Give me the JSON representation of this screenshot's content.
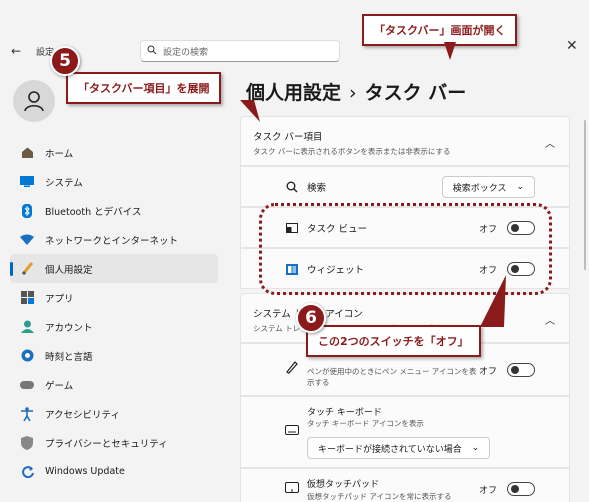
{
  "header": {
    "back_icon": "back-arrow-icon",
    "settings_label": "設定",
    "search_placeholder": "設定の検索"
  },
  "page_title": {
    "parent": "個人用設定",
    "separator": "›",
    "current": "タスク バー"
  },
  "sidebar": {
    "items": [
      {
        "label": "ホーム",
        "icon": "home-icon"
      },
      {
        "label": "システム",
        "icon": "system-icon"
      },
      {
        "label": "Bluetooth とデバイス",
        "icon": "bluetooth-icon"
      },
      {
        "label": "ネットワークとインターネット",
        "icon": "wifi-icon"
      },
      {
        "label": "個人用設定",
        "icon": "brush-icon",
        "active": true
      },
      {
        "label": "アプリ",
        "icon": "apps-icon"
      },
      {
        "label": "アカウント",
        "icon": "account-icon"
      },
      {
        "label": "時刻と言語",
        "icon": "globe-icon"
      },
      {
        "label": "ゲーム",
        "icon": "gamepad-icon"
      },
      {
        "label": "アクセシビリティ",
        "icon": "accessibility-icon"
      },
      {
        "label": "プライバシーとセキュリティ",
        "icon": "shield-icon"
      },
      {
        "label": "Windows Update",
        "icon": "update-icon"
      }
    ]
  },
  "taskbar_items": {
    "title": "タスク バー項目",
    "subtitle": "タスク バーに表示されるボタンを表示または非表示にする",
    "search": {
      "label": "検索",
      "value": "検索ボックス"
    },
    "task_view": {
      "label": "タスク ビュー",
      "state": "オフ"
    },
    "widgets": {
      "label": "ウィジェット",
      "state": "オフ"
    }
  },
  "system_tray": {
    "title": "システム トレイ アイコン",
    "subtitle": "システム トレイに表示されるアイコンを表示または非表示にする",
    "pen_menu": {
      "sub1": "ペンが使用中のときにペン メニュー アイコンを表",
      "sub2": "示する",
      "state": "オフ"
    },
    "touch_keyboard": {
      "title": "タッチ キーボード",
      "sub": "タッチ キーボード アイコンを表示",
      "value": "キーボードが接続されていない場合"
    },
    "touchpad": {
      "title": "仮想タッチパッド",
      "sub": "仮想タッチパッド アイコンを常に表示する",
      "state": "オフ"
    }
  },
  "annotations": {
    "callout_top": "「タスクバー」画面が開く",
    "badge5": "5",
    "callout5": "「タスクバー項目」を展開",
    "badge6": "6",
    "callout6": "この2つのスイッチを「オフ」"
  }
}
